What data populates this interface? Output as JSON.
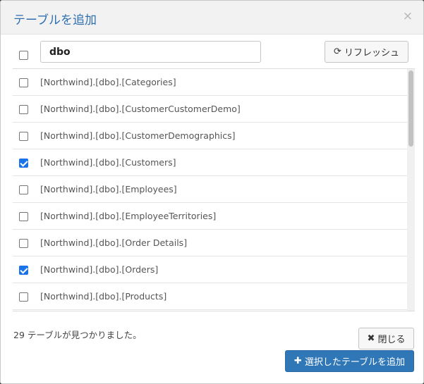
{
  "dialog": {
    "title": "テーブルを追加",
    "close_glyph": "×"
  },
  "search": {
    "value": "dbo",
    "placeholder": ""
  },
  "refresh_button": {
    "icon": "refresh-icon",
    "glyph": "⟳",
    "label": "リフレッシュ"
  },
  "tables": [
    {
      "label": "[Northwind].[dbo].[Categories]",
      "checked": false
    },
    {
      "label": "[Northwind].[dbo].[CustomerCustomerDemo]",
      "checked": false
    },
    {
      "label": "[Northwind].[dbo].[CustomerDemographics]",
      "checked": false
    },
    {
      "label": "[Northwind].[dbo].[Customers]",
      "checked": true
    },
    {
      "label": "[Northwind].[dbo].[Employees]",
      "checked": false
    },
    {
      "label": "[Northwind].[dbo].[EmployeeTerritories]",
      "checked": false
    },
    {
      "label": "[Northwind].[dbo].[Order Details]",
      "checked": false
    },
    {
      "label": "[Northwind].[dbo].[Orders]",
      "checked": true
    },
    {
      "label": "[Northwind].[dbo].[Products]",
      "checked": false
    }
  ],
  "footer": {
    "found_text": "29 テーブルが見つかりました。",
    "close_button": {
      "icon": "times-icon",
      "glyph": "✖",
      "label": "閉じる"
    },
    "add_button": {
      "icon": "plus-icon",
      "glyph": "✚",
      "label": "選択したテーブルを追加"
    }
  },
  "colors": {
    "title": "#2f6fb0",
    "primary": "#2f77b7",
    "checkbox_checked": "#1a73e8"
  }
}
